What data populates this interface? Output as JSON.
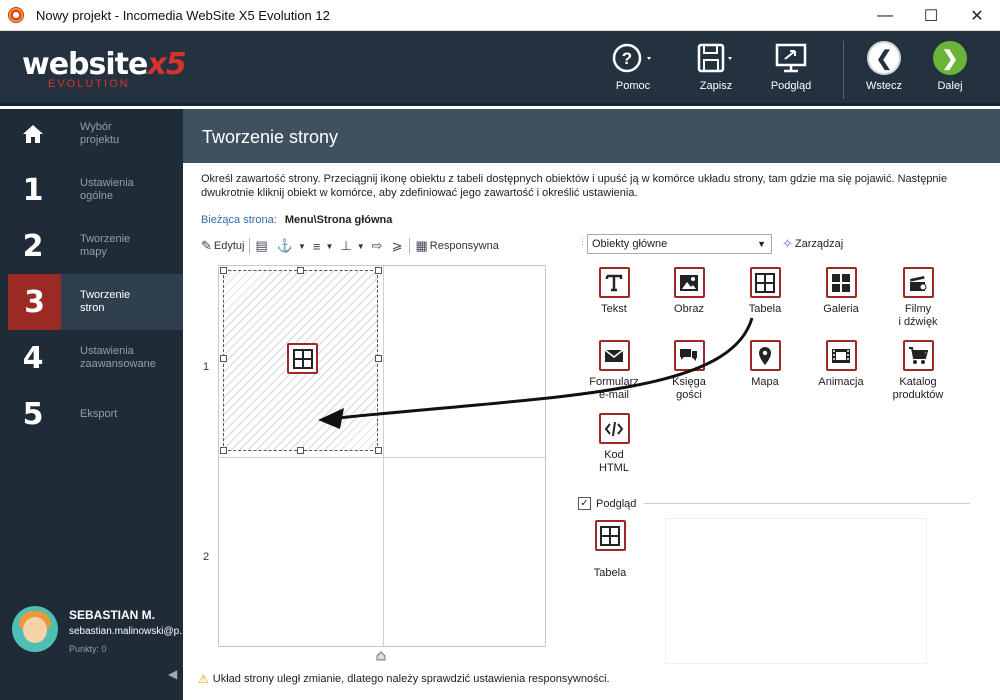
{
  "window": {
    "title": "Nowy projekt - Incomedia WebSite X5 Evolution 12"
  },
  "logo": {
    "main": "website",
    "x5": "x5",
    "sub": "EVOLUTION"
  },
  "header": {
    "help": "Pomoc",
    "save": "Zapisz",
    "preview": "Podgląd",
    "back": "Wstecz",
    "next": "Dalej"
  },
  "sidebar": {
    "steps": [
      {
        "num": "",
        "label": "Wybór\nprojektu"
      },
      {
        "num": "1",
        "label": "Ustawienia\nogólne"
      },
      {
        "num": "2",
        "label": "Tworzenie\nmapy"
      },
      {
        "num": "3",
        "label": "Tworzenie\nstron"
      },
      {
        "num": "4",
        "label": "Ustawienia\nzaawansowane"
      },
      {
        "num": "5",
        "label": "Eksport"
      }
    ],
    "active_step": "3",
    "user": {
      "name": "SEBASTIAN M.",
      "email": "sebastian.malinowski@p...",
      "points": "Punkty: 0"
    }
  },
  "main": {
    "title": "Tworzenie strony",
    "description": "Określ zawartość strony. Przeciągnij ikonę obiektu z tabeli dostępnych obiektów i upuść ją w komórce układu strony, tam gdzie ma się pojawić. Następnie dwukrotnie kliknij obiekt w komórce, aby zdefiniować jego zawartość i określić ustawienia.",
    "current_page_label": "Bieżąca strona:",
    "current_page_value": "Menu\\Strona główna",
    "toolbar": {
      "edit": "Edytuj",
      "responsive": "Responsywna"
    },
    "rows": [
      "1",
      "2"
    ],
    "warning": "Układ strony uległ zmianie, dlatego należy sprawdzić ustawienia responsywności."
  },
  "objects": {
    "category": "Obiekty główne",
    "manage": "Zarządzaj",
    "items": [
      {
        "label": "Tekst",
        "icon": "text-icon"
      },
      {
        "label": "Obraz",
        "icon": "image-icon"
      },
      {
        "label": "Tabela",
        "icon": "table-icon"
      },
      {
        "label": "Galeria",
        "icon": "gallery-icon"
      },
      {
        "label": "Filmy\ni dźwięk",
        "icon": "video-icon"
      },
      {
        "label": "Formularz\ne-mail",
        "icon": "mail-icon"
      },
      {
        "label": "Księga\ngości",
        "icon": "chat-icon"
      },
      {
        "label": "Mapa",
        "icon": "map-pin-icon"
      },
      {
        "label": "Animacja",
        "icon": "film-icon"
      },
      {
        "label": "Katalog\nproduktów",
        "icon": "cart-icon"
      },
      {
        "label": "Kod\nHTML",
        "icon": "code-icon"
      }
    ],
    "preview_label": "Podgląd",
    "preview_item": "Tabela"
  },
  "colors": {
    "header_bg": "#243240",
    "sidebar_bg": "#1f2c38",
    "accent_red": "#9c2a24",
    "next_green": "#6ab43a"
  }
}
